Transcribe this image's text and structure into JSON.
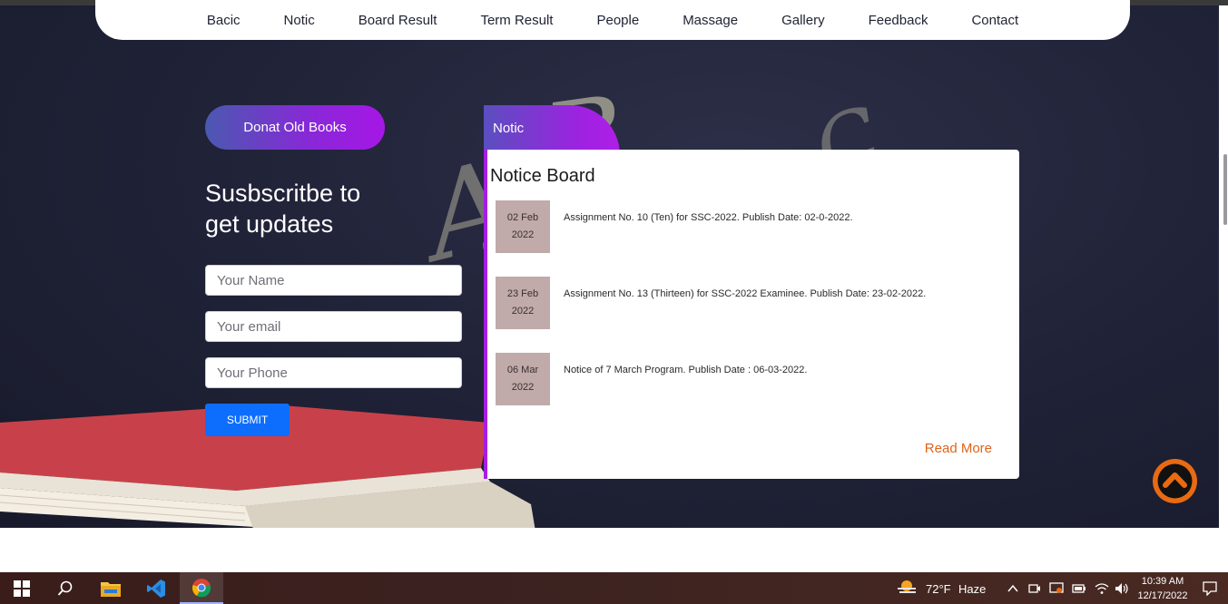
{
  "nav": {
    "items": [
      "Bacic",
      "Notic",
      "Board Result",
      "Term Result",
      "People",
      "Massage",
      "Gallery",
      "Feedback",
      "Contact"
    ]
  },
  "subscribe": {
    "donate_label": "Donat Old Books",
    "title_line1": "Susbscritbe to",
    "title_line2": "get updates",
    "name_placeholder": "Your Name",
    "email_placeholder": "Your email",
    "phone_placeholder": "Your Phone",
    "submit_label": "SUBMIT"
  },
  "notice": {
    "tab_label": "Notic",
    "heading": "Notice Board",
    "items": [
      {
        "date_day": "02 Feb",
        "date_year": "2022",
        "text": "Assignment No. 10 (Ten) for SSC-2022. Publish Date: 02-0-2022."
      },
      {
        "date_day": "23 Feb",
        "date_year": "2022",
        "text": "Assignment No. 13 (Thirteen) for SSC-2022 Examinee. Publish Date: 23-02-2022."
      },
      {
        "date_day": "06 Mar",
        "date_year": "2022",
        "text": "Notice of 7 March Program. Publish Date : 06-03-2022."
      }
    ],
    "read_more": "Read More"
  },
  "taskbar": {
    "weather_temp": "72°F",
    "weather_desc": "Haze",
    "time": "10:39 AM",
    "date": "12/17/2022"
  },
  "colors": {
    "accent_purple": "#a41ee4",
    "submit_blue": "#0d6efd",
    "read_more_orange": "#e0631a",
    "date_box": "#c0aaaa"
  }
}
